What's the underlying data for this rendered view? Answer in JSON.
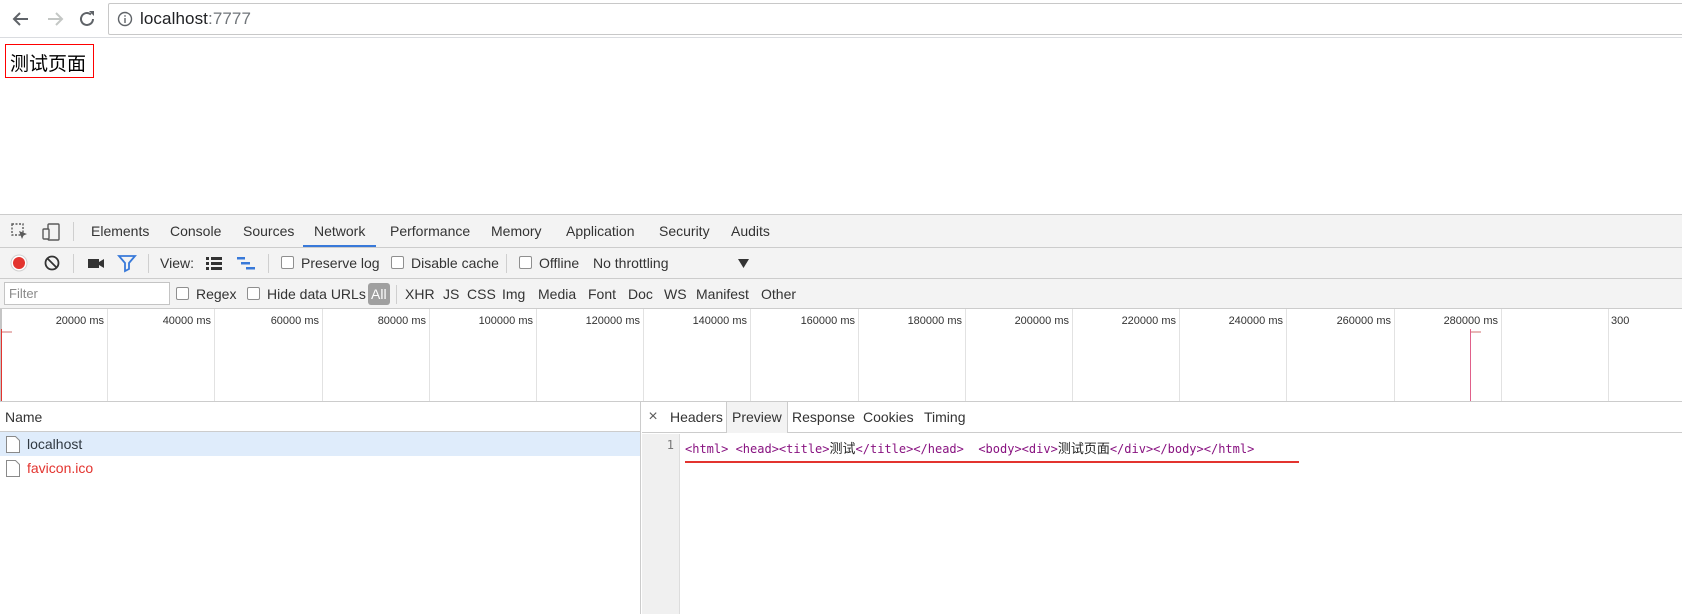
{
  "browser": {
    "url_host": "localhost",
    "url_port": ":7777"
  },
  "page": {
    "content_text": "测试页面"
  },
  "devtools": {
    "tabs": [
      "Elements",
      "Console",
      "Sources",
      "Network",
      "Performance",
      "Memory",
      "Application",
      "Security",
      "Audits"
    ],
    "active_tab": "Network",
    "toolbar": {
      "view_label": "View:",
      "preserve_log": "Preserve log",
      "disable_cache": "Disable cache",
      "offline": "Offline",
      "throttling": "No throttling"
    },
    "filter": {
      "placeholder": "Filter",
      "regex": "Regex",
      "hide_data_urls": "Hide data URLs",
      "types": [
        "All",
        "XHR",
        "JS",
        "CSS",
        "Img",
        "Media",
        "Font",
        "Doc",
        "WS",
        "Manifest",
        "Other"
      ],
      "active_type": "All"
    },
    "timeline_ticks": [
      "20000 ms",
      "40000 ms",
      "60000 ms",
      "80000 ms",
      "100000 ms",
      "120000 ms",
      "140000 ms",
      "160000 ms",
      "180000 ms",
      "200000 ms",
      "220000 ms",
      "240000 ms",
      "260000 ms",
      "280000 ms",
      "300"
    ],
    "requests": {
      "column_name": "Name",
      "rows": [
        {
          "name": "localhost",
          "selected": true,
          "error": false
        },
        {
          "name": "favicon.ico",
          "selected": false,
          "error": true
        }
      ]
    },
    "detail": {
      "close": "×",
      "tabs": [
        "Headers",
        "Preview",
        "Response",
        "Cookies",
        "Timing"
      ],
      "active_tab": "Preview",
      "line_number": "1",
      "code": {
        "t1": "<html> <head><title>",
        "x1": "测试",
        "t2": "</title></head>  <body><div>",
        "x2": "测试页面",
        "t3": "</div></body></html>"
      }
    }
  },
  "colors": {
    "accent_blue": "#3879d9",
    "record_red": "#e3342f",
    "selected_row": "#dfecfb",
    "tag_purple": "#881280"
  }
}
